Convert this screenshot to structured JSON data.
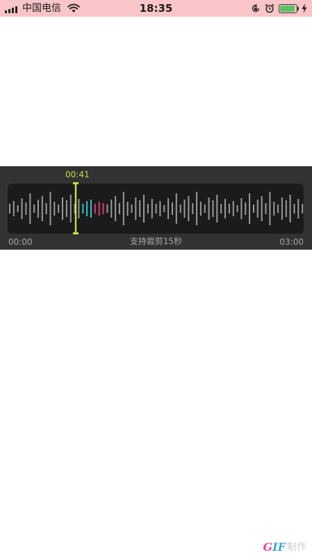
{
  "status_bar": {
    "carrier": "中国电信",
    "time": "18:35",
    "signal_bars": 4,
    "battery_level": 1.0,
    "icons": [
      "signal-icon",
      "wifi-icon",
      "orientation-lock-icon",
      "alarm-icon",
      "battery-icon",
      "charging-icon"
    ]
  },
  "trim": {
    "marker_time": "00:41",
    "start_time": "00:00",
    "end_time": "03:00",
    "hint": "支持裁剪15秒",
    "colors": {
      "panel": "#323232",
      "track": "#1b1b1c",
      "wave": "#9a9a9a",
      "marker": "#c8de42",
      "highlight_cyan": "#2ec4c9",
      "highlight_pink": "#e0377d"
    }
  },
  "watermark": {
    "logo": "GIF",
    "text": "制作"
  }
}
